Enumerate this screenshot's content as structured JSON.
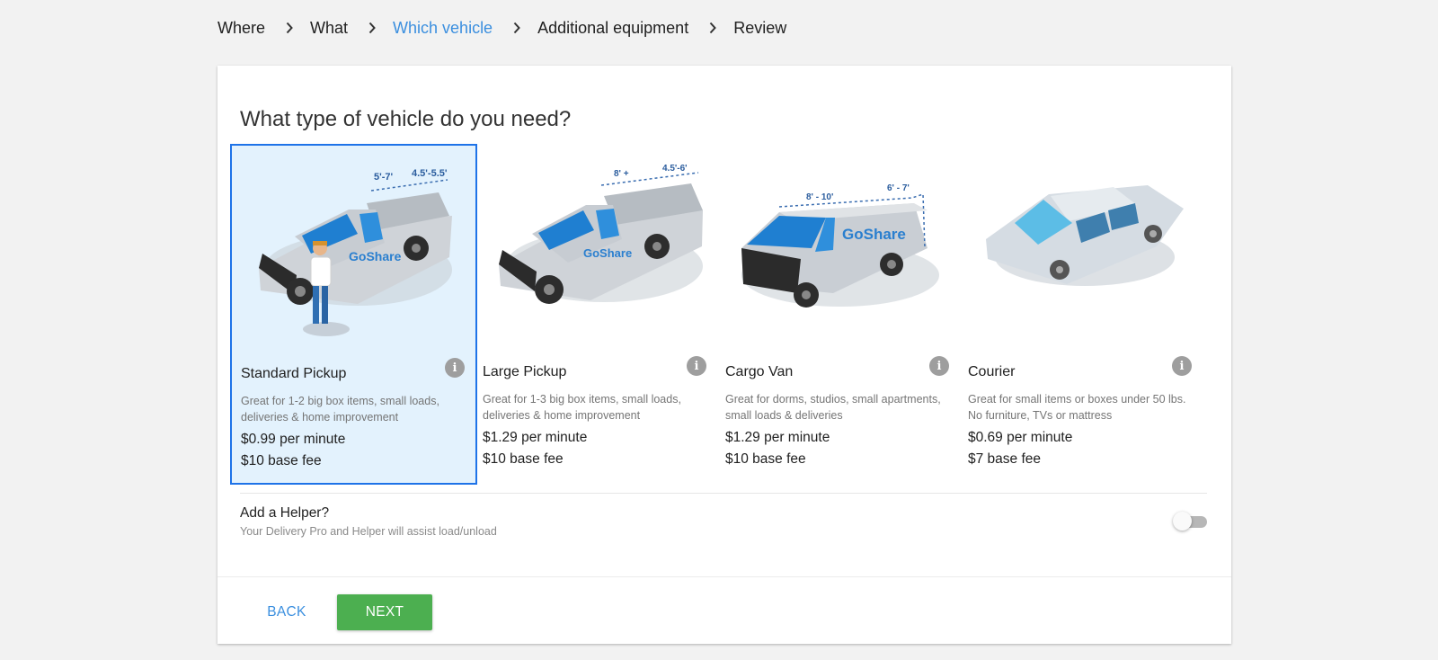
{
  "breadcrumb": {
    "steps": [
      {
        "label": "Where",
        "active": false
      },
      {
        "label": "What",
        "active": false
      },
      {
        "label": "Which vehicle",
        "active": true
      },
      {
        "label": "Additional equipment",
        "active": false
      },
      {
        "label": "Review",
        "active": false
      }
    ],
    "separator_icon": "chevron-right-icon"
  },
  "main": {
    "heading": "What type of vehicle do you need?",
    "vehicles": [
      {
        "name": "Standard Pickup",
        "description": "Great for 1-2 big box items, small loads, deliveries & home improvement",
        "price": "$0.99 per minute",
        "fee": "$10 base fee",
        "selected": true,
        "dimensions": [
          "5'-7'",
          "4.5'-5.5'"
        ],
        "brand": "GoShare",
        "icon": "pickup-truck-with-driver-illustration"
      },
      {
        "name": "Large Pickup",
        "description": "Great for 1-3 big box items, small loads, deliveries & home improvement",
        "price": "$1.29 per minute",
        "fee": "$10 base fee",
        "selected": false,
        "dimensions": [
          "8' +",
          "4.5'-6'"
        ],
        "brand": "GoShare",
        "icon": "large-pickup-truck-illustration"
      },
      {
        "name": "Cargo Van",
        "description": "Great for dorms, studios, small apartments, small loads & deliveries",
        "price": "$1.29 per minute",
        "fee": "$10 base fee",
        "selected": false,
        "dimensions": [
          "8' - 10'",
          "6' - 7'"
        ],
        "brand": "GoShare",
        "icon": "cargo-van-illustration"
      },
      {
        "name": "Courier",
        "description": "Great for small items or boxes under 50 lbs. No furniture, TVs or mattress",
        "price": "$0.69 per minute",
        "fee": "$7 base fee",
        "selected": false,
        "icon": "sedan-car-illustration"
      }
    ],
    "info_icon": "info-icon",
    "helper": {
      "title": "Add a Helper?",
      "subtitle": "Your Delivery Pro and Helper will assist load/unload",
      "enabled": false
    }
  },
  "footer": {
    "back_label": "BACK",
    "next_label": "NEXT"
  },
  "colors": {
    "accent": "#3b8fdf",
    "selected_border": "#1e73e8",
    "selected_bg": "#e3f2fd",
    "next_button": "#4caf50",
    "info_icon": "#9e9e9e"
  }
}
